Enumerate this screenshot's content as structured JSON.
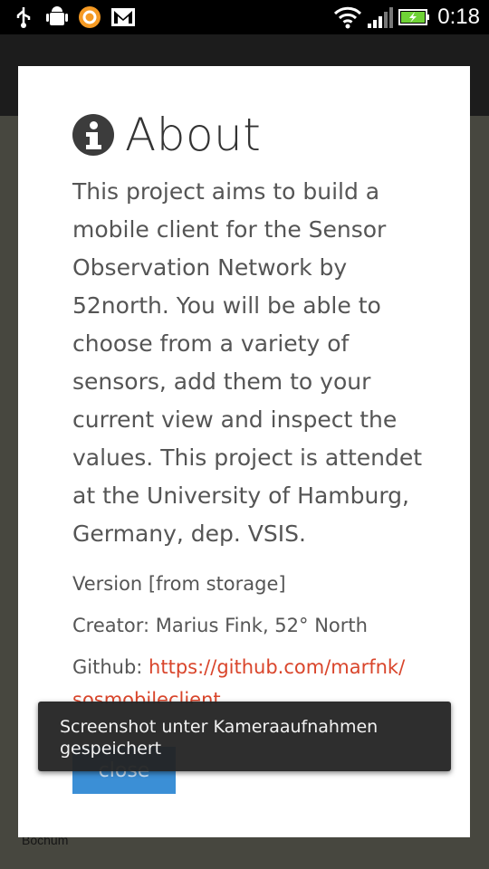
{
  "status_bar": {
    "time": "0:18",
    "left_icons": [
      "usb-icon",
      "android-debug-icon",
      "orange-app-icon",
      "gmail-icon"
    ],
    "right_icons": [
      "wifi-icon",
      "signal-icon",
      "battery-charging-icon"
    ]
  },
  "background": {
    "map_labels": [
      "Bochum"
    ]
  },
  "dialog": {
    "title": "About",
    "title_icon": "info-icon",
    "description": "This project aims to build a mobile client for the Sensor Observation Network by 52north. You will be able to choose from a variety of sensors, add them to your current view and inspect the values. This project is attendet at the University of Hamburg, Germany, dep. VSIS.",
    "version": "Version [from storage]",
    "creator": "Creator: Marius Fink, 52° North",
    "github_label": "Github: ",
    "github_url": "https://github.com/marfnk/",
    "github_url_cont": "sosmobileclient",
    "close_label": "close"
  },
  "toast": {
    "message": "Screenshot unter Kameraaufnahmen gespeichert"
  },
  "colors": {
    "link": "#d9452b",
    "button": "#3b8fd6",
    "battery": "#6fd236"
  }
}
